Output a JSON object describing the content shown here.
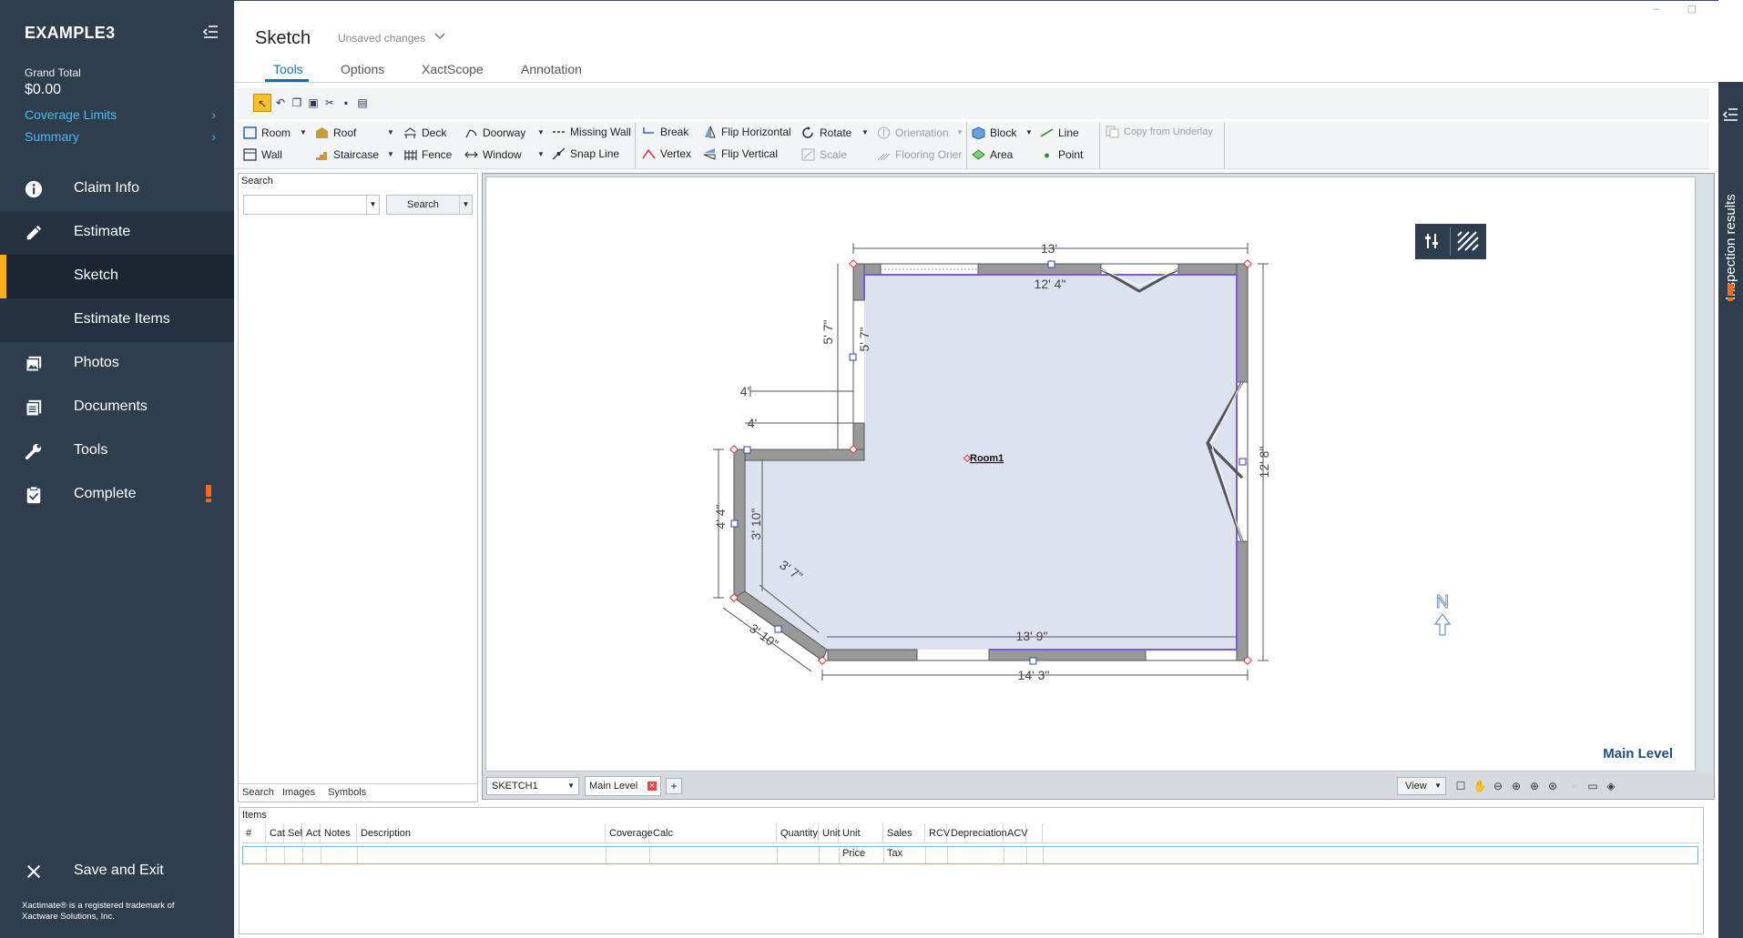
{
  "sidebar": {
    "title": "EXAMPLE3",
    "grand_total_label": "Grand Total",
    "grand_total_value": "$0.00",
    "coverage_limits": "Coverage Limits",
    "summary": "Summary",
    "nav": {
      "claim_info": "Claim Info",
      "estimate": "Estimate",
      "sketch": "Sketch",
      "estimate_items": "Estimate Items",
      "photos": "Photos",
      "documents": "Documents",
      "tools": "Tools",
      "complete": "Complete",
      "save_exit": "Save and Exit"
    },
    "footer_line1": "Xactimate® is a registered trademark of",
    "footer_line2": "Xactware Solutions, Inc.",
    "accent_color": "#f7b016",
    "alert_color": "#ff6a1a"
  },
  "header": {
    "title": "Sketch",
    "status": "Unsaved changes",
    "tabs": [
      "Tools",
      "Options",
      "XactScope",
      "Annotation"
    ]
  },
  "toolbar": {
    "room": "Room",
    "wall": "Wall",
    "roof": "Roof",
    "staircase": "Staircase",
    "deck": "Deck",
    "fence": "Fence",
    "doorway": "Doorway",
    "window": "Window",
    "missing_wall": "Missing Wall",
    "snap_line": "Snap Line",
    "break": "Break",
    "vertex": "Vertex",
    "flip_horizontal": "Flip Horizontal",
    "flip_vertical": "Flip Vertical",
    "rotate": "Rotate",
    "scale": "Scale",
    "orientation": "Orientation",
    "flooring_orient": "Flooring Orier",
    "block": "Block",
    "area": "Area",
    "line": "Line",
    "point": "Point",
    "copy_underlay": "Copy from Underlay"
  },
  "search_panel": {
    "title": "Search",
    "button": "Search",
    "tabs": [
      "Search",
      "Images",
      "Symbols"
    ]
  },
  "sketch": {
    "room_label": "Room1",
    "dims": {
      "top_outer": "13'",
      "top_inner": "12' 4\"",
      "left_upper_outer": "5' 7\"",
      "left_upper_inner": "5' 7\"",
      "step_outer": "4'",
      "step_inner": "4'",
      "left_lower_outer": "4' 4\"",
      "left_lower_inner": "3' 10\"",
      "diag_inner": "3' 7\"",
      "diag_outer": "3' 10\"",
      "bottom_inner": "13' 9\"",
      "bottom_outer": "14' 3\"",
      "right_outer": "12' 8\""
    },
    "level_label": "Main Level",
    "sketch_select": "SKETCH1",
    "level_tab": "Main Level",
    "add_tab": "+",
    "view_label": "View",
    "north": "N"
  },
  "items": {
    "title": "Items",
    "columns": [
      "#",
      "Cat",
      "Sel",
      "Act",
      "Notes",
      "Description",
      "Coverage",
      "Calc",
      "Quantity",
      "Unit",
      "Unit Price",
      "Sales Tax",
      "RCV",
      "Depreciation",
      "ACV"
    ]
  },
  "right_panel": {
    "label": "Inspection results"
  }
}
